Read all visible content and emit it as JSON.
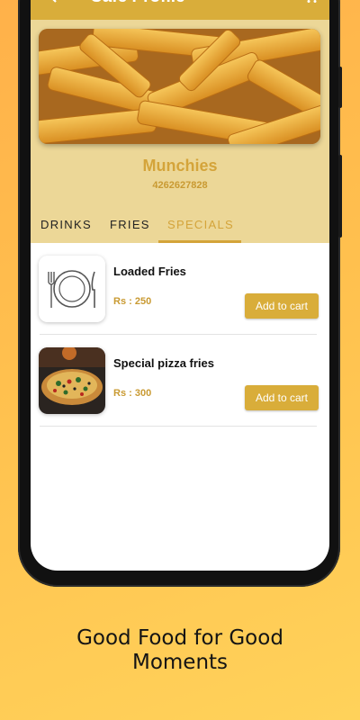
{
  "appbar": {
    "title": "Cafe Profile"
  },
  "cafe": {
    "name": "Munchies",
    "phone": "4262627828"
  },
  "tabs": [
    {
      "label": "DRINKS",
      "active": false
    },
    {
      "label": "FRIES",
      "active": false
    },
    {
      "label": "SPECIALS",
      "active": true
    }
  ],
  "items": [
    {
      "name": "Loaded Fries",
      "price": "Rs : 250",
      "button": "Add to cart",
      "image": "plate-cutlery-icon"
    },
    {
      "name": "Special pizza fries",
      "price": "Rs : 300",
      "button": "Add to cart",
      "image": "pizza-fries-photo"
    }
  ],
  "tagline": {
    "line1": "Good Food for Good",
    "line2": "Moments"
  },
  "colors": {
    "accent": "#d9ad3a",
    "header_bg": "#ecd797",
    "price": "#c99a32"
  }
}
